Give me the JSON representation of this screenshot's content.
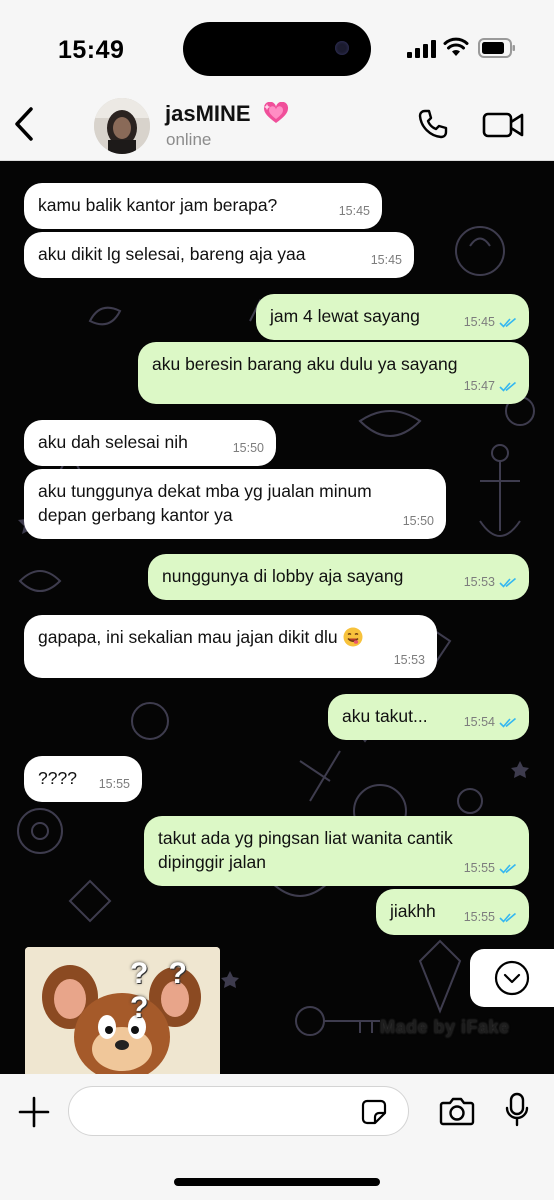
{
  "status_bar": {
    "time": "15:49"
  },
  "contact": {
    "name": "jasMINE",
    "status": "online"
  },
  "messages": [
    {
      "dir": "in",
      "text": "kamu balik kantor jam berapa?",
      "time": "15:45"
    },
    {
      "dir": "in",
      "text": "aku dikit lg selesai, bareng aja yaa",
      "time": "15:45"
    },
    {
      "dir": "out",
      "text": "jam 4 lewat sayang",
      "time": "15:45"
    },
    {
      "dir": "out",
      "text": "aku beresin barang aku dulu ya sayang",
      "time": "15:47"
    },
    {
      "dir": "in",
      "text": "aku dah selesai nih",
      "time": "15:50"
    },
    {
      "dir": "in",
      "line1": "aku tunggunya dekat mba yg jualan minum",
      "line2": "depan gerbang kantor ya",
      "time": "15:50"
    },
    {
      "dir": "out",
      "text": "nunggunya di lobby aja sayang",
      "time": "15:53"
    },
    {
      "dir": "in",
      "text": "gapapa, ini sekalian mau jajan dikit dlu",
      "time": "15:53"
    },
    {
      "dir": "out",
      "text": "aku takut...",
      "time": "15:54"
    },
    {
      "dir": "in",
      "text": "????",
      "time": "15:55"
    },
    {
      "dir": "out",
      "line1": "takut ada yg pingsan liat wanita cantik",
      "line2": "dipinggir jalan",
      "time": "15:55"
    },
    {
      "dir": "out",
      "text": "jiakhh",
      "time": "15:55"
    }
  ],
  "sticker": {
    "caption": "? ? ?"
  },
  "watermark": "Made by iFake",
  "icons": {
    "back": "chevron-left-icon",
    "call": "phone-icon",
    "video": "video-camera-icon",
    "plus": "plus-icon",
    "sticker": "sticker-icon",
    "camera": "camera-icon",
    "mic": "microphone-icon",
    "scroll": "chevron-down-icon",
    "tick": "double-check-icon",
    "heart": "sparkling-heart-emoji",
    "emoji": "smiling-face-emoji"
  },
  "colors": {
    "incoming_bubble": "#ffffff",
    "outgoing_bubble": "#dcf8c6",
    "chat_bg": "#050505",
    "tick_blue": "#34b7f1",
    "header_bg": "#f6f6f6"
  }
}
